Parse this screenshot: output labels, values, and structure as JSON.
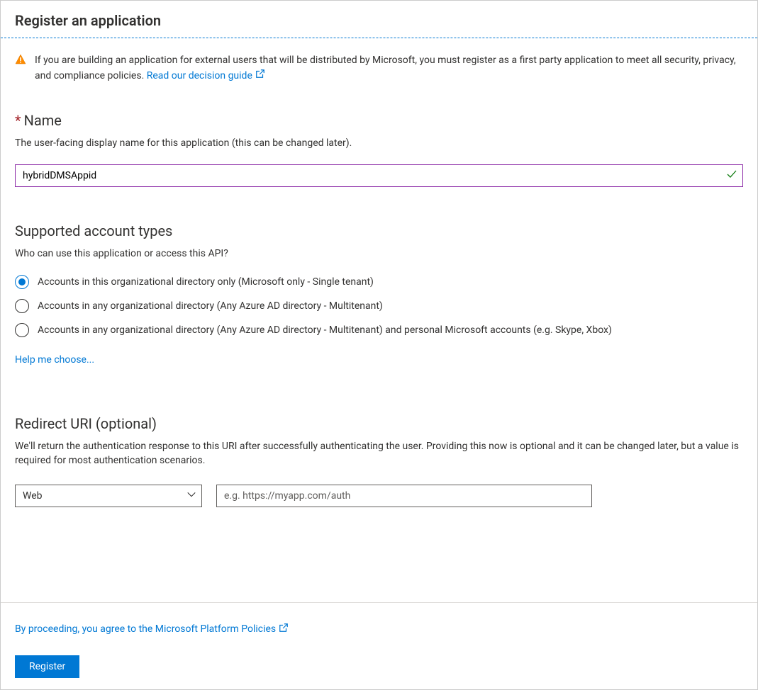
{
  "header": {
    "title": "Register an application"
  },
  "alert": {
    "text_part1": "If you are building an application for external users that will be distributed by Microsoft, you must register as a first party application to meet all security, privacy, and compliance policies. ",
    "link_text": "Read our decision guide"
  },
  "name_section": {
    "label": "Name",
    "description": "The user-facing display name for this application (this can be changed later).",
    "value": "hybridDMSAppid"
  },
  "account_types": {
    "title": "Supported account types",
    "description": "Who can use this application or access this API?",
    "options": [
      {
        "label": "Accounts in this organizational directory only (Microsoft only - Single tenant)",
        "selected": true
      },
      {
        "label": "Accounts in any organizational directory (Any Azure AD directory - Multitenant)",
        "selected": false
      },
      {
        "label": "Accounts in any organizational directory (Any Azure AD directory - Multitenant) and personal Microsoft accounts (e.g. Skype, Xbox)",
        "selected": false
      }
    ],
    "help_link": "Help me choose..."
  },
  "redirect": {
    "title": "Redirect URI (optional)",
    "description": "We'll return the authentication response to this URI after successfully authenticating the user. Providing this now is optional and it can be changed later, but a value is required for most authentication scenarios.",
    "type_selected": "Web",
    "uri_placeholder": "e.g. https://myapp.com/auth"
  },
  "footer": {
    "policy_text": "By proceeding, you agree to the Microsoft Platform Policies",
    "register_label": "Register"
  }
}
